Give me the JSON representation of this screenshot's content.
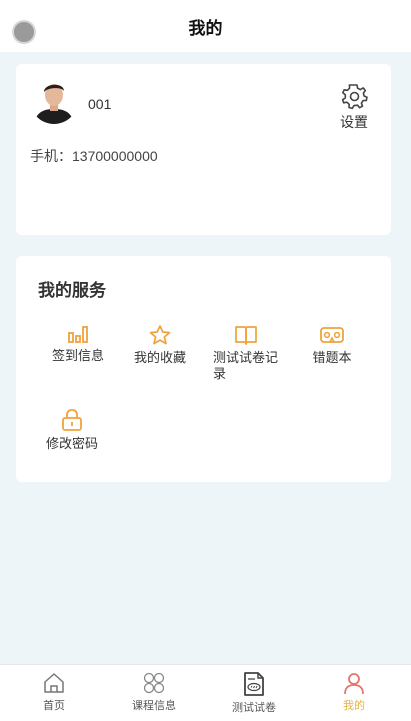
{
  "header": {
    "title": "我的"
  },
  "profile": {
    "username": "001",
    "phone_label": "手机：",
    "phone": "13700000000",
    "settings_label": "设置"
  },
  "services": {
    "title": "我的服务",
    "items": [
      {
        "label": "签到信息",
        "icon": "bar-chart-icon"
      },
      {
        "label": "我的收藏",
        "icon": "star-icon"
      },
      {
        "label": "测试试卷记录",
        "icon": "book-icon"
      },
      {
        "label": "错题本",
        "icon": "vr-glasses-icon"
      },
      {
        "label": "修改密码",
        "icon": "lock-icon"
      }
    ]
  },
  "tabbar": {
    "items": [
      {
        "label": "首页",
        "icon": "home-icon"
      },
      {
        "label": "课程信息",
        "icon": "clover-icon"
      },
      {
        "label": "测试试卷",
        "icon": "exam-paper-icon"
      },
      {
        "label": "我的",
        "icon": "person-icon"
      }
    ],
    "active_index": 3
  },
  "colors": {
    "accent": "#f0a23c",
    "active_tab": "#e6b43a",
    "active_tab_icon": "#e8736c",
    "background": "#eef5f8"
  }
}
